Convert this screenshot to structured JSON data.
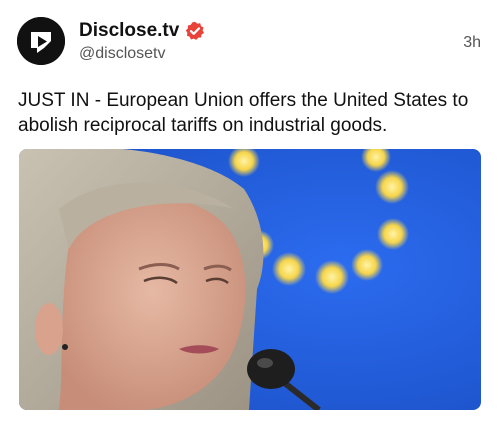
{
  "post": {
    "author": {
      "display_name": "Disclose.tv",
      "handle": "@disclosetv",
      "verified": true,
      "avatar_icon": "play-logo-icon"
    },
    "timestamp": "3h",
    "text": "JUST IN - European Union offers the United States to abolish reciprocal tariffs on industrial goods.",
    "media": {
      "type": "photo",
      "description_icon": "news-photo"
    }
  },
  "colors": {
    "verified": "#e8433a",
    "eu_blue": "#1f5ad6",
    "star": "#f6d54a",
    "text": "#111111",
    "secondary": "#555555"
  }
}
